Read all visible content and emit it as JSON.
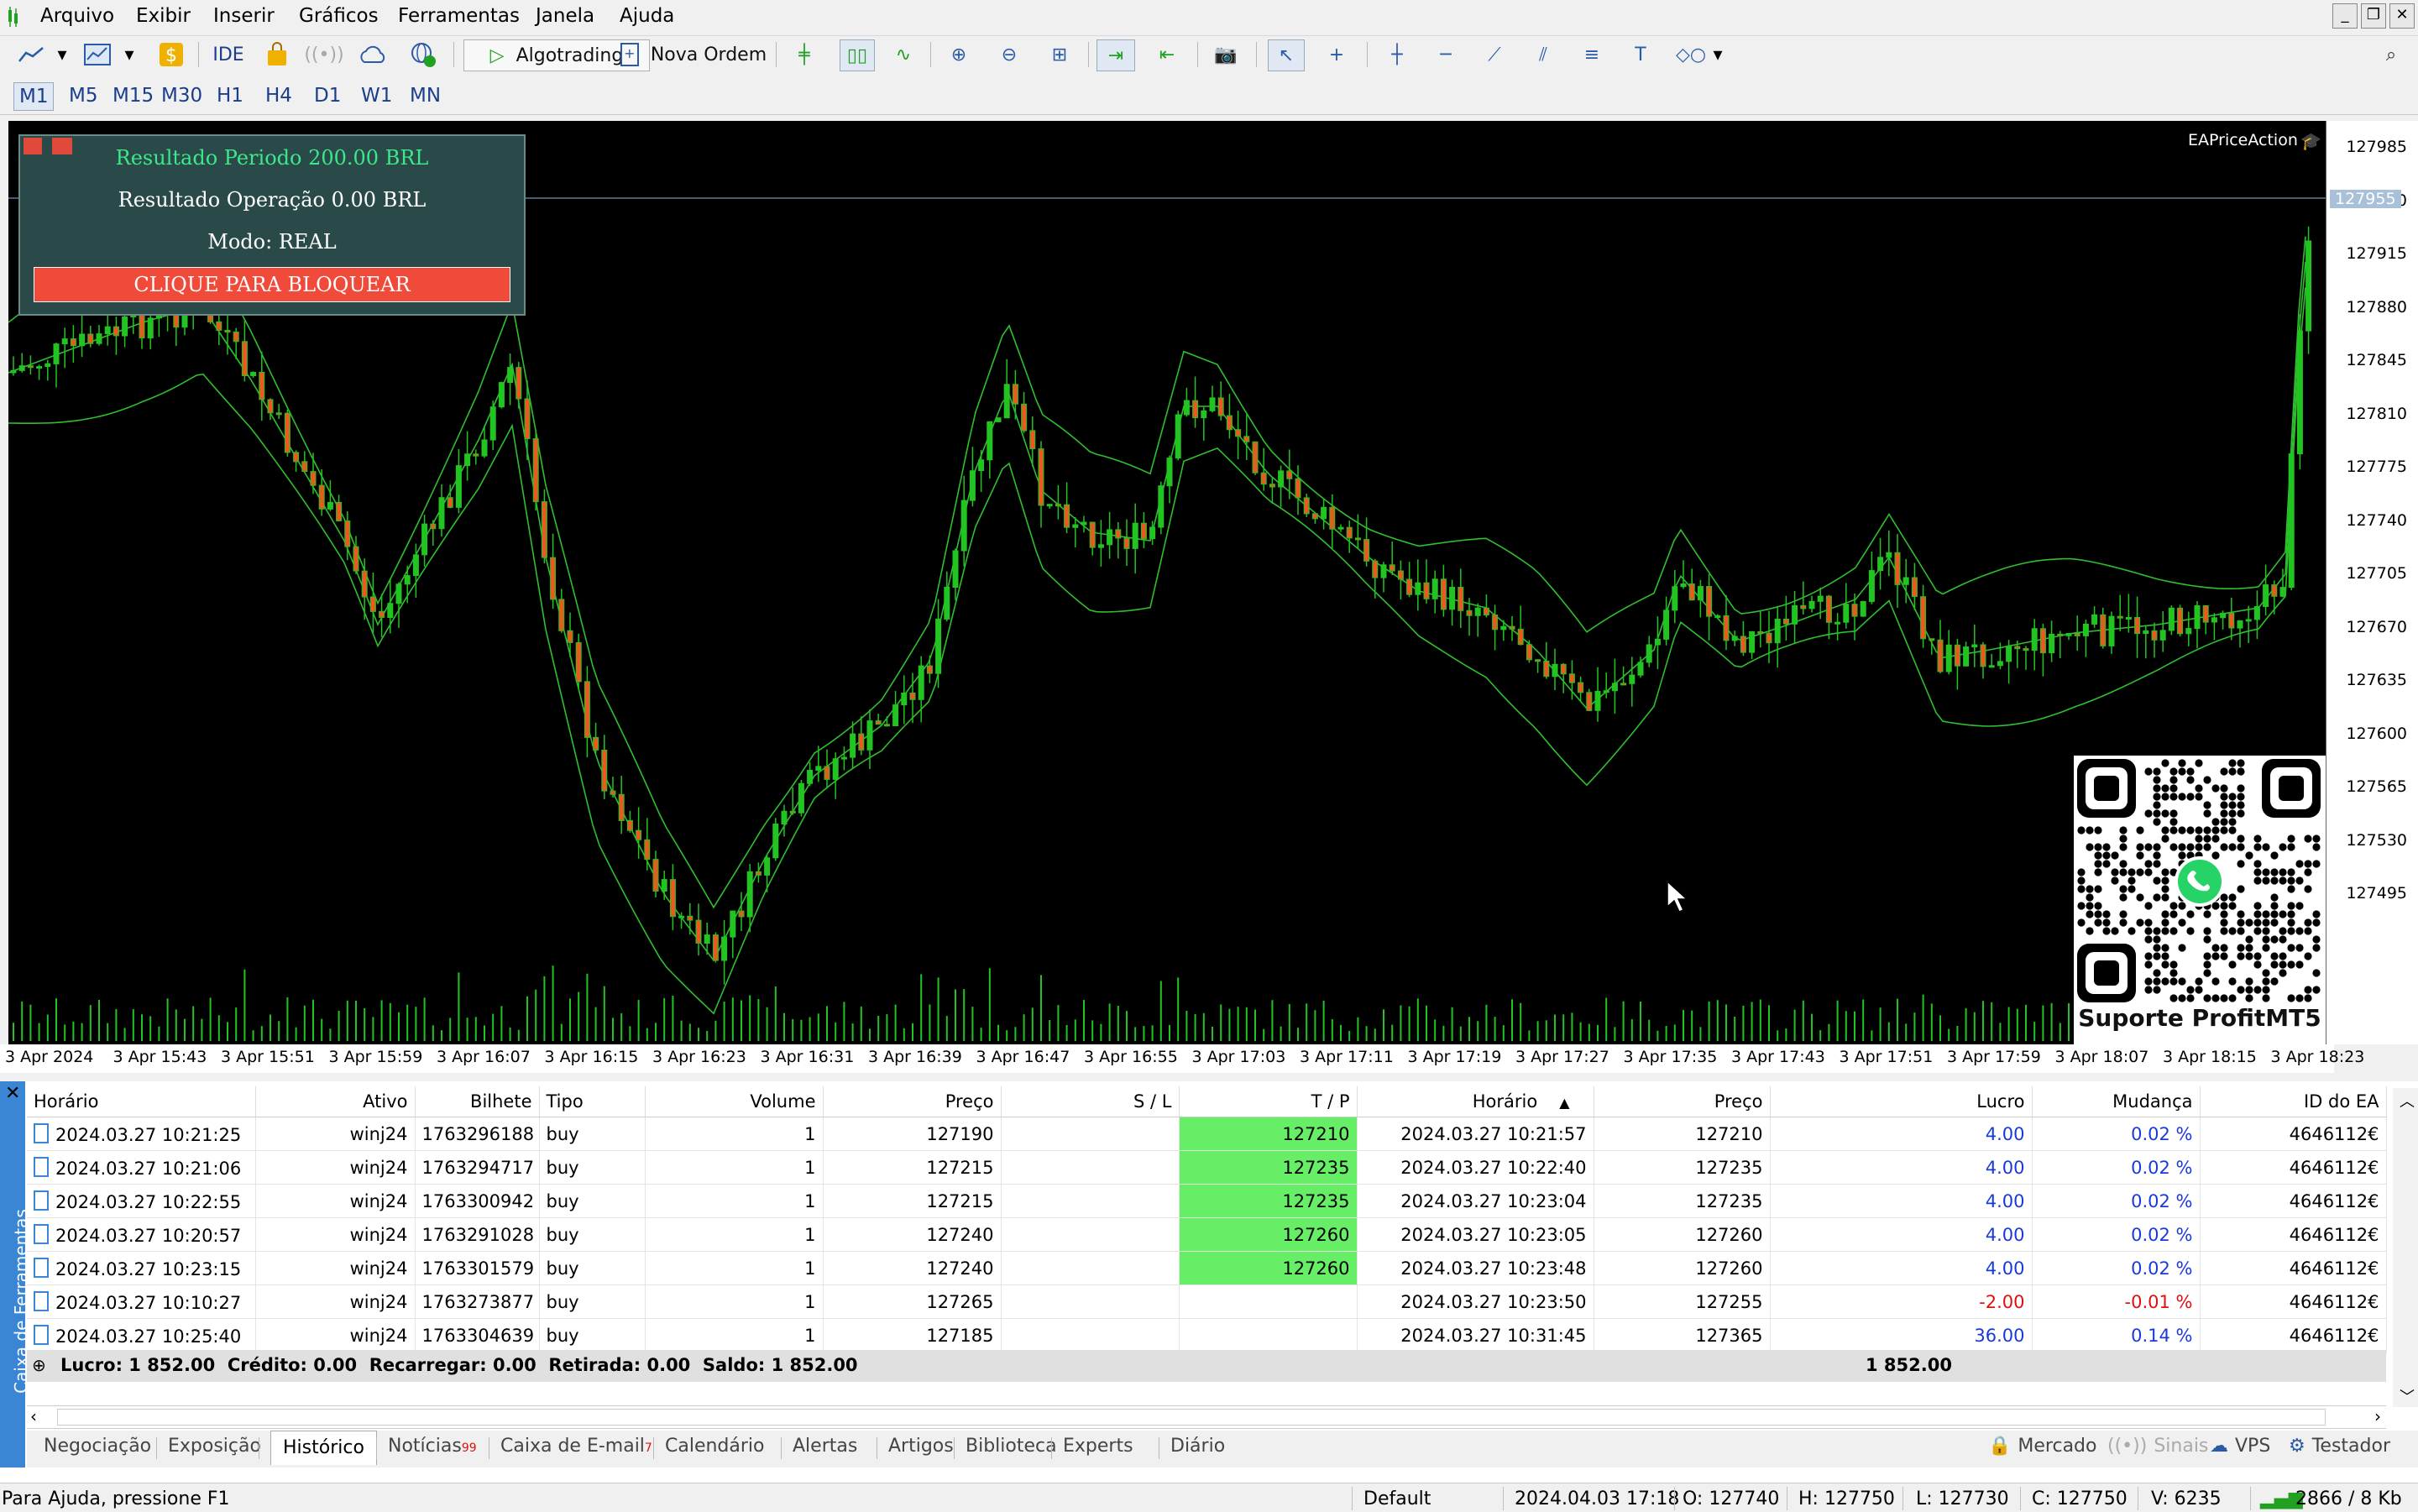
{
  "menu": [
    "Arquivo",
    "Exibir",
    "Inserir",
    "Gráficos",
    "Ferramentas",
    "Janela",
    "Ajuda"
  ],
  "toolbar": {
    "ide": "IDE",
    "algotrading": "Algotrading",
    "nova_ordem": "Nova Ordem"
  },
  "timeframes": [
    "M1",
    "M5",
    "M15",
    "M30",
    "H1",
    "H4",
    "D1",
    "W1",
    "MN"
  ],
  "active_timeframe": "M1",
  "chart": {
    "expert_name": "EAPriceAction",
    "price_label": "127955",
    "y_ticks": [
      "127985",
      "127950",
      "127915",
      "127880",
      "127845",
      "127810",
      "127775",
      "127740",
      "127705",
      "127670",
      "127635",
      "127600",
      "127565",
      "127530",
      "127495"
    ],
    "x_ticks": [
      "3 Apr 2024",
      "3 Apr 15:43",
      "3 Apr 15:51",
      "3 Apr 15:59",
      "3 Apr 16:07",
      "3 Apr 16:15",
      "3 Apr 16:23",
      "3 Apr 16:31",
      "3 Apr 16:39",
      "3 Apr 16:47",
      "3 Apr 16:55",
      "3 Apr 17:03",
      "3 Apr 17:11",
      "3 Apr 17:19",
      "3 Apr 17:27",
      "3 Apr 17:35",
      "3 Apr 17:43",
      "3 Apr 17:51",
      "3 Apr 17:59",
      "3 Apr 18:07",
      "3 Apr 18:15",
      "3 Apr 18:23"
    ],
    "colors": {
      "bull": "#22c422",
      "bear": "#e85a20",
      "band": "#2fbf2f",
      "background": "#000000"
    }
  },
  "panel": {
    "resultado_periodo": "Resultado Periodo 200.00 BRL",
    "resultado_operacao": "Resultado Operação 0.00 BRL",
    "modo": "Modo: REAL",
    "button": "CLIQUE PARA BLOQUEAR"
  },
  "qr": {
    "label": "Suporte ProfitMT5"
  },
  "toolbox": {
    "sidebar_label": "Caixa de Ferramentas",
    "columns": [
      "Horário",
      "Ativo",
      "Bilhete",
      "Tipo",
      "Volume",
      "Preço",
      "S / L",
      "T / P",
      "Horário",
      "Preço",
      "Lucro",
      "Mudança",
      "ID do EA"
    ],
    "rows": [
      {
        "open": "2024.03.27 10:21:25",
        "symbol": "winj24",
        "ticket": "1763296188",
        "type": "buy",
        "volume": "1",
        "price": "127190",
        "sl": "",
        "tp": "127210",
        "close_time": "2024.03.27 10:21:57",
        "close_price": "127210",
        "profit": "4.00",
        "change": "0.02 %",
        "ea": "4646112€"
      },
      {
        "open": "2024.03.27 10:21:06",
        "symbol": "winj24",
        "ticket": "1763294717",
        "type": "buy",
        "volume": "1",
        "price": "127215",
        "sl": "",
        "tp": "127235",
        "close_time": "2024.03.27 10:22:40",
        "close_price": "127235",
        "profit": "4.00",
        "change": "0.02 %",
        "ea": "4646112€"
      },
      {
        "open": "2024.03.27 10:22:55",
        "symbol": "winj24",
        "ticket": "1763300942",
        "type": "buy",
        "volume": "1",
        "price": "127215",
        "sl": "",
        "tp": "127235",
        "close_time": "2024.03.27 10:23:04",
        "close_price": "127235",
        "profit": "4.00",
        "change": "0.02 %",
        "ea": "4646112€"
      },
      {
        "open": "2024.03.27 10:20:57",
        "symbol": "winj24",
        "ticket": "1763291028",
        "type": "buy",
        "volume": "1",
        "price": "127240",
        "sl": "",
        "tp": "127260",
        "close_time": "2024.03.27 10:23:05",
        "close_price": "127260",
        "profit": "4.00",
        "change": "0.02 %",
        "ea": "4646112€"
      },
      {
        "open": "2024.03.27 10:23:15",
        "symbol": "winj24",
        "ticket": "1763301579",
        "type": "buy",
        "volume": "1",
        "price": "127240",
        "sl": "",
        "tp": "127260",
        "close_time": "2024.03.27 10:23:48",
        "close_price": "127260",
        "profit": "4.00",
        "change": "0.02 %",
        "ea": "4646112€"
      },
      {
        "open": "2024.03.27 10:10:27",
        "symbol": "winj24",
        "ticket": "1763273877",
        "type": "buy",
        "volume": "1",
        "price": "127265",
        "sl": "",
        "tp": "",
        "close_time": "2024.03.27 10:23:50",
        "close_price": "127255",
        "profit": "-2.00",
        "change": "-0.01 %",
        "ea": "4646112€"
      },
      {
        "open": "2024.03.27 10:25:40",
        "symbol": "winj24",
        "ticket": "1763304639",
        "type": "buy",
        "volume": "1",
        "price": "127185",
        "sl": "",
        "tp": "",
        "close_time": "2024.03.27 10:31:45",
        "close_price": "127365",
        "profit": "36.00",
        "change": "0.14 %",
        "ea": "4646112€"
      }
    ],
    "summary": "Lucro: 1 852.00  Crédito: 0.00  Recarregar: 0.00  Retirada: 0.00  Saldo: 1 852.00",
    "summary_total": "1 852.00",
    "tabs": [
      {
        "label": "Negociação"
      },
      {
        "label": "Exposição"
      },
      {
        "label": "Histórico",
        "active": true
      },
      {
        "label": "Notícias",
        "badge": "99"
      },
      {
        "label": "Caixa de E-mail",
        "badge": "7"
      },
      {
        "label": "Calendário"
      },
      {
        "label": "Alertas"
      },
      {
        "label": "Artigos"
      },
      {
        "label": "Biblioteca"
      },
      {
        "label": "Experts"
      },
      {
        "label": "Diário"
      }
    ],
    "right_tabs": [
      "Mercado",
      "Sinais",
      "VPS",
      "Testador"
    ]
  },
  "status": {
    "help": "Para Ajuda, pressione F1",
    "profile": "Default",
    "datetime": "2024.04.03 17:18",
    "open": "O: 127740",
    "high": "H: 127750",
    "low": "L: 127730",
    "close": "C: 127750",
    "volume": "V: 6235",
    "traffic": "2866 / 8 Kb"
  }
}
